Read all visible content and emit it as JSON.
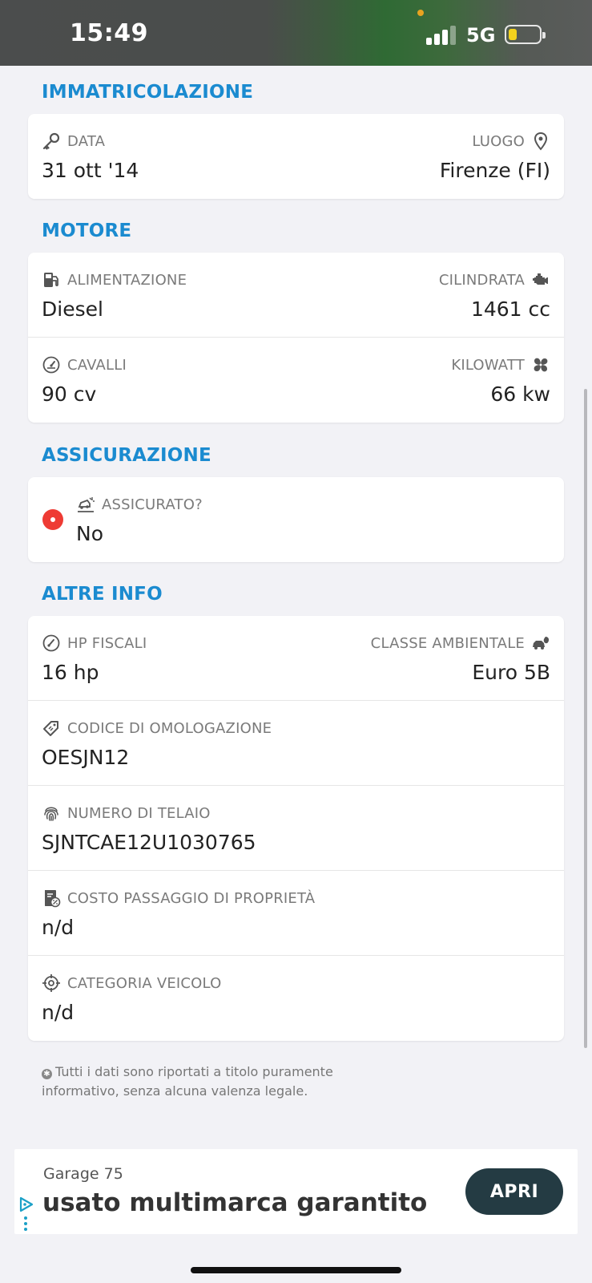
{
  "status_bar": {
    "time": "15:49",
    "network": "5G",
    "signal_bars_filled": 3,
    "battery_level": 0.2,
    "battery_color": "#f3d31d"
  },
  "colors": {
    "section_title": "#1b8bd0",
    "alert_red": "#ee3b34",
    "ad_button": "#243b43"
  },
  "registration": {
    "title": "IMMATRICOLAZIONE",
    "date_label": "DATA",
    "date_value": "31 ott '14",
    "date_icon": "key-icon",
    "place_label": "LUOGO",
    "place_value": "Firenze (FI)",
    "place_icon": "location-pin-icon"
  },
  "engine": {
    "title": "MOTORE",
    "fuel_label": "ALIMENTAZIONE",
    "fuel_value": "Diesel",
    "fuel_icon": "fuel-pump-icon",
    "displacement_label": "CILINDRATA",
    "displacement_value": "1461 cc",
    "displacement_icon": "engine-icon",
    "horsepower_label": "CAVALLI",
    "horsepower_value": "90 cv",
    "horsepower_icon": "speedometer-icon",
    "kilowatt_label": "KILOWATT",
    "kilowatt_value": "66 kw",
    "kilowatt_icon": "fan-icon"
  },
  "insurance": {
    "title": "ASSICURAZIONE",
    "label": "ASSICURATO?",
    "value": "No",
    "icon": "car-crash-icon"
  },
  "other_info": {
    "title": "ALTRE INFO",
    "fiscal_hp_label": "HP FISCALI",
    "fiscal_hp_value": "16 hp",
    "fiscal_hp_icon": "gauge-icon",
    "env_class_label": "CLASSE AMBIENTALE",
    "env_class_value": "Euro 5B",
    "env_class_icon": "car-leaf-icon",
    "homologation_label": "CODICE DI OMOLOGAZIONE",
    "homologation_value": "OESJN12",
    "homologation_icon": "tag-icon",
    "chassis_label": "NUMERO DI TELAIO",
    "chassis_value": "SJNTCAE12U1030765",
    "chassis_icon": "fingerprint-icon",
    "transfer_cost_label": "COSTO PASSAGGIO DI PROPRIETÀ",
    "transfer_cost_value": "n/d",
    "transfer_cost_icon": "document-percent-icon",
    "category_label": "CATEGORIA VEICOLO",
    "category_value": "n/d",
    "category_icon": "crosshair-icon"
  },
  "disclaimer": {
    "line1": "Tutti i dati sono riportati a titolo puramente",
    "line2": "informativo, senza alcuna valenza legale."
  },
  "ad": {
    "advertiser": "Garage 75",
    "headline": "usato multimarca garantito",
    "button_label": "APRI"
  }
}
